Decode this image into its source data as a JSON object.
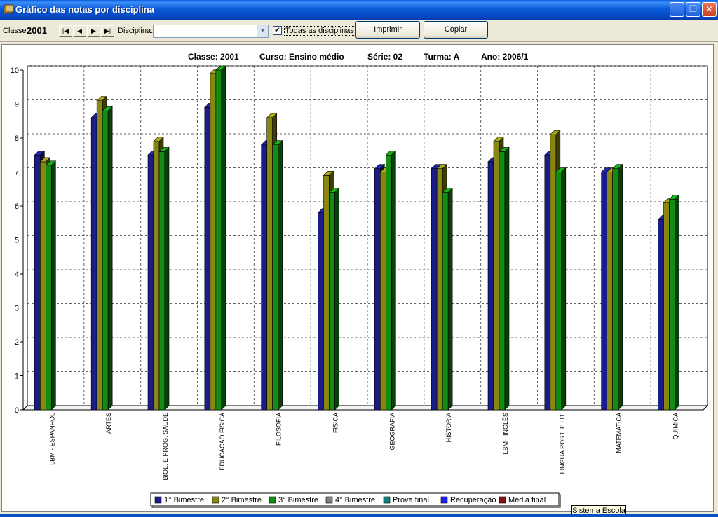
{
  "window": {
    "title": "Gráfico das notas por disciplina"
  },
  "toolbar": {
    "classe_label": "Classe:",
    "classe_value": "2001",
    "nav": [
      "|◀",
      "◀",
      "▶",
      "▶|"
    ],
    "disciplina_label": "Disciplina:",
    "disciplina_value": "",
    "todas_checked": true,
    "todas_label": "Todas as disciplinas",
    "imprimir_label": "Imprimir",
    "copiar_label": "Copiar"
  },
  "header": {
    "classe": "Classe: 2001",
    "curso": "Curso: Ensino médio",
    "serie": "Série: 02",
    "turma": "Turma: A",
    "ano": "Ano: 2006/1"
  },
  "status_tip": "Sistema Escola",
  "colors": {
    "b1": "#1b1b8a",
    "b2": "#878712",
    "b3": "#148c14",
    "b4": "#808080",
    "prova": "#128080",
    "rec": "#1f1fe8",
    "media": "#8a1212"
  },
  "chart_data": {
    "type": "bar",
    "ylim": [
      0,
      10
    ],
    "yticks": [
      "0",
      "1",
      "2",
      "3",
      "4",
      "5",
      "6",
      "7",
      "8",
      "9",
      "10"
    ],
    "categories": [
      "LBM - ESPANHOL",
      "ARTES",
      "BIOL. E PROG. SAUDE",
      "EDUCACAO FISICA",
      "FILOSOFIA",
      "FISICA",
      "GEOGRAFIA",
      "HISTORIA",
      "LBM - INGLÊS",
      "LINGUA PORT. E LIT.",
      "MATEMATICA",
      "QUIMICA"
    ],
    "series": [
      {
        "name": "1° Bimestre",
        "color": "#1b1b8a",
        "values": [
          7.5,
          8.6,
          7.5,
          8.9,
          7.8,
          5.8,
          7.1,
          7.1,
          7.3,
          7.5,
          7.0,
          5.6
        ]
      },
      {
        "name": "2° Bimestre",
        "color": "#878712",
        "values": [
          7.3,
          9.1,
          7.9,
          9.9,
          8.6,
          6.9,
          7.0,
          7.1,
          7.9,
          8.1,
          7.0,
          6.1
        ]
      },
      {
        "name": "3° Bimestre",
        "color": "#148c14",
        "values": [
          7.2,
          8.8,
          7.6,
          10.0,
          7.8,
          6.4,
          7.5,
          6.4,
          7.6,
          7.0,
          7.1,
          6.2
        ]
      }
    ],
    "legend": [
      {
        "name": "1° Bimestre",
        "color": "#1b1b8a"
      },
      {
        "name": "2° Bimestre",
        "color": "#878712"
      },
      {
        "name": "3° Bimestre",
        "color": "#148c14"
      },
      {
        "name": "4° Bimestre",
        "color": "#808080"
      },
      {
        "name": "Prova final",
        "color": "#128080"
      },
      {
        "name": "Recuperação",
        "color": "#1f1fe8"
      },
      {
        "name": "Média final",
        "color": "#8a1212"
      }
    ],
    "legend_position": "bottom",
    "grid": true
  }
}
